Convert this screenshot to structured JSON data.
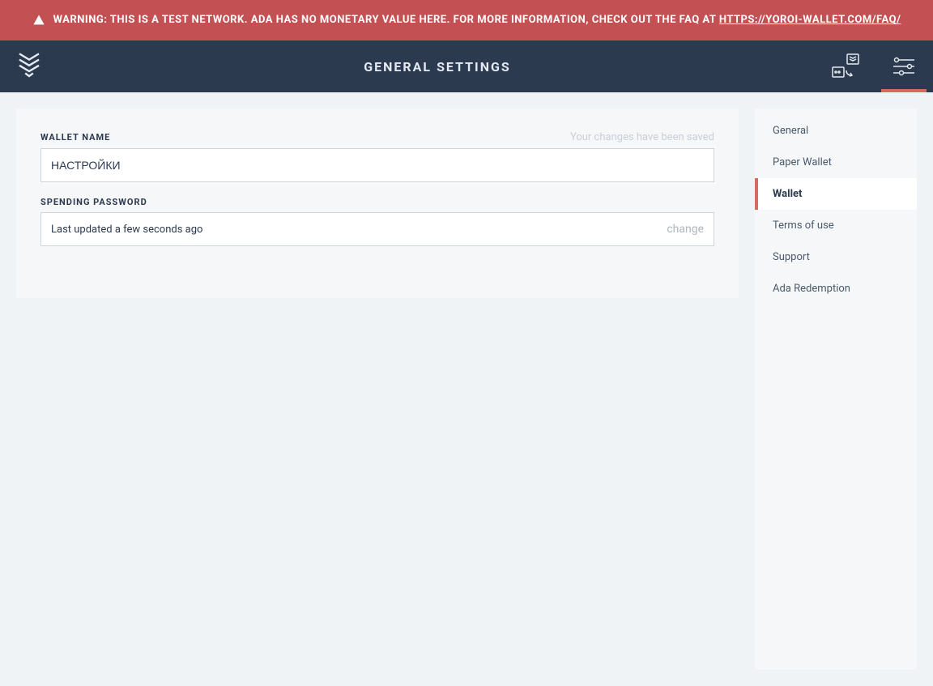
{
  "warning": {
    "prefix": "WARNING: THIS IS A TEST NETWORK. ADA HAS NO MONETARY VALUE HERE. FOR MORE INFORMATION, CHECK OUT THE FAQ AT ",
    "link_text": "HTTPS://YOROI-WALLET.COM/FAQ/"
  },
  "header": {
    "title": "GENERAL SETTINGS"
  },
  "form": {
    "wallet_name": {
      "label": "WALLET NAME",
      "value": "НАСТРОЙКИ",
      "saved_message": "Your changes have been saved"
    },
    "spending_password": {
      "label": "SPENDING PASSWORD",
      "updated_text": "Last updated a few seconds ago",
      "change_label": "change"
    }
  },
  "sidebar": {
    "items": [
      {
        "label": "General",
        "active": false
      },
      {
        "label": "Paper Wallet",
        "active": false
      },
      {
        "label": "Wallet",
        "active": true
      },
      {
        "label": "Terms of use",
        "active": false
      },
      {
        "label": "Support",
        "active": false
      },
      {
        "label": "Ada Redemption",
        "active": false
      }
    ]
  }
}
